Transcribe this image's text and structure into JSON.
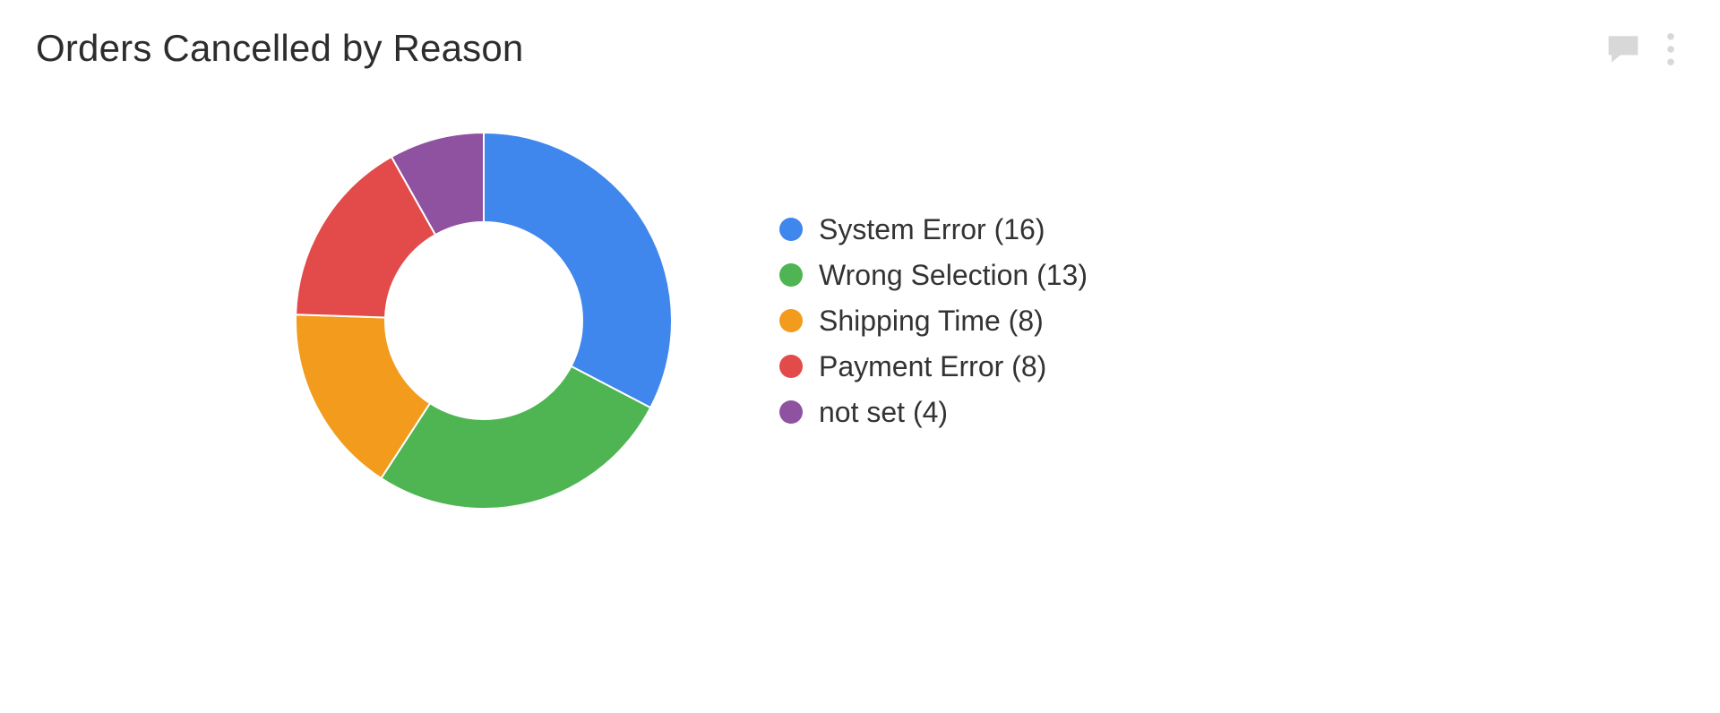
{
  "card": {
    "title": "Orders Cancelled by Reason"
  },
  "chart_data": {
    "type": "pie",
    "title": "Orders Cancelled by Reason",
    "donut": true,
    "series": [
      {
        "name": "System Error",
        "value": 16,
        "color": "#3f86ed"
      },
      {
        "name": "Wrong Selection",
        "value": 13,
        "color": "#4fb452"
      },
      {
        "name": "Shipping Time",
        "value": 8,
        "color": "#f29b1d"
      },
      {
        "name": "Payment Error",
        "value": 8,
        "color": "#e24b4a"
      },
      {
        "name": "not set",
        "value": 4,
        "color": "#8f52a0"
      }
    ]
  },
  "legend": {
    "items": [
      {
        "label": "System Error (16)",
        "color": "#3f86ed"
      },
      {
        "label": "Wrong Selection (13)",
        "color": "#4fb452"
      },
      {
        "label": "Shipping Time (8)",
        "color": "#f29b1d"
      },
      {
        "label": "Payment Error (8)",
        "color": "#e24b4a"
      },
      {
        "label": "not set (4)",
        "color": "#8f52a0"
      }
    ]
  }
}
